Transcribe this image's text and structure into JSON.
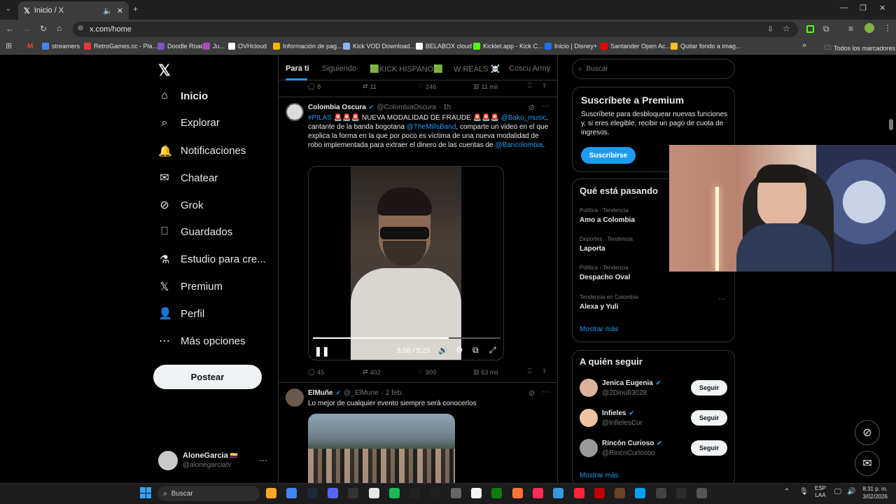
{
  "browser": {
    "tab_title": "Inicio / X",
    "url": "x.com/home",
    "bookmarks": [
      {
        "label": "streamers",
        "color": "#4285f4"
      },
      {
        "label": "RetroGames.cc - Pla...",
        "color": "#e53935"
      },
      {
        "label": "Doodle Road",
        "color": "#7e57c2"
      },
      {
        "label": "Ju...",
        "color": "#ab47bc"
      },
      {
        "label": "OVHcloud",
        "color": "#ffffff"
      },
      {
        "label": "Información de pag...",
        "color": "#f4b400"
      },
      {
        "label": "Kick VOD Download...",
        "color": "#8ab4f8"
      },
      {
        "label": "BELABOX cloud",
        "color": "#ffffff"
      },
      {
        "label": "Kicklet.app - Kick C...",
        "color": "#53fc18"
      },
      {
        "label": "Inicio | Disney+",
        "color": "#1a73e8"
      },
      {
        "label": "Santander Open Ac...",
        "color": "#ec0000"
      },
      {
        "label": "Quitar fondo a imag...",
        "color": "#fbc02d"
      }
    ],
    "all_bookmarks": "Todos los marcadores"
  },
  "nav": {
    "items": [
      "Inicio",
      "Explorar",
      "Notificaciones",
      "Chatear",
      "Grok",
      "Guardados",
      "Estudio para cre...",
      "Premium",
      "Perfil",
      "Más opciones"
    ],
    "post_label": "Postear",
    "account": {
      "name": "AloneGarcia",
      "handle": "@alonegarciatv"
    }
  },
  "feed": {
    "tabs": [
      "Para ti",
      "Siguiendo",
      "🟩KICK HISPANO🟩",
      "W REALS ☠️",
      "Coscu Army"
    ],
    "prev_actions": {
      "replies": "8",
      "reposts": "11",
      "likes": "246",
      "views": "11 mil"
    },
    "tweet1": {
      "name": "Colombia Oscura",
      "handle": "@ColombiaOscura",
      "time": "· 1h",
      "hashtag": "#PILAS",
      "emoji": "🚨🚨🚨",
      "headline": " NUEVA MODALIDAD DE FRAUDE ",
      "mention1": "@Bako_music",
      "text_a": ", cantante de la banda bogotana ",
      "mention2": "@TheMillsBand",
      "text_b": ", comparte un video en el que explica la forma en la que por poco es víctima de una nueva modalidad de robo implementada para extraer el dinero de las cuentas de ",
      "mention3": "@Bancolombia",
      "text_c": ".",
      "video_time": "3:58 / 5:29",
      "actions": {
        "replies": "45",
        "reposts": "402",
        "likes": "909",
        "views": "63 mil"
      }
    },
    "tweet2": {
      "name": "ElMuñe",
      "handle": "@_ElMune",
      "time": "· 2 feb.",
      "text": "Lo mejor de cualquier evento siempre será conocerlos"
    }
  },
  "sidebar": {
    "search_placeholder": "Buscar",
    "premium": {
      "title": "Suscríbete a Premium",
      "body": "Suscríbete para desbloquear nuevas funciones y, si eres elegible, recibir un pago de cuota de ingresos.",
      "button": "Suscribirse"
    },
    "trends_title": "Qué está pasando",
    "trends": [
      {
        "category": "Política · Tendencia",
        "name": "Amo a Colombia"
      },
      {
        "category": "Deportes · Tendencia",
        "name": "Laporta"
      },
      {
        "category": "Política · Tendencia",
        "name": "Despacho Oval"
      },
      {
        "category": "Tendencia en Colombia",
        "name": "Alexa y Yuli"
      }
    ],
    "show_more": "Mostrar más",
    "follow_title": "A quién seguir",
    "follow": [
      {
        "name": "Jenica Eugenia",
        "handle": "@2Dinu83028"
      },
      {
        "name": "Infieles",
        "handle": "@InfielesCor"
      },
      {
        "name": "Rincón Curioso",
        "handle": "@RincnCurlosoo"
      }
    ],
    "follow_btn": "Seguir",
    "follow_more": "Mostrar más"
  },
  "taskbar": {
    "search": "Buscar",
    "lang1": "ESP",
    "lang2": "LAA",
    "time": "8:31 p. m.",
    "date": "3/02/2026",
    "icon_colors": [
      "#f9a825",
      "#4285f4",
      "#1b2838",
      "#5865f2",
      "#333333",
      "#e8e8e8",
      "#1db954",
      "#222222",
      "#202020",
      "#666666",
      "#f5f5f5",
      "#107c10",
      "#ff7139",
      "#fe2c55",
      "#3a96dd",
      "#fa243c",
      "#bf0000",
      "#6b4226",
      "#00a3ff",
      "#444444",
      "#2b2b2b",
      "#555555"
    ]
  }
}
